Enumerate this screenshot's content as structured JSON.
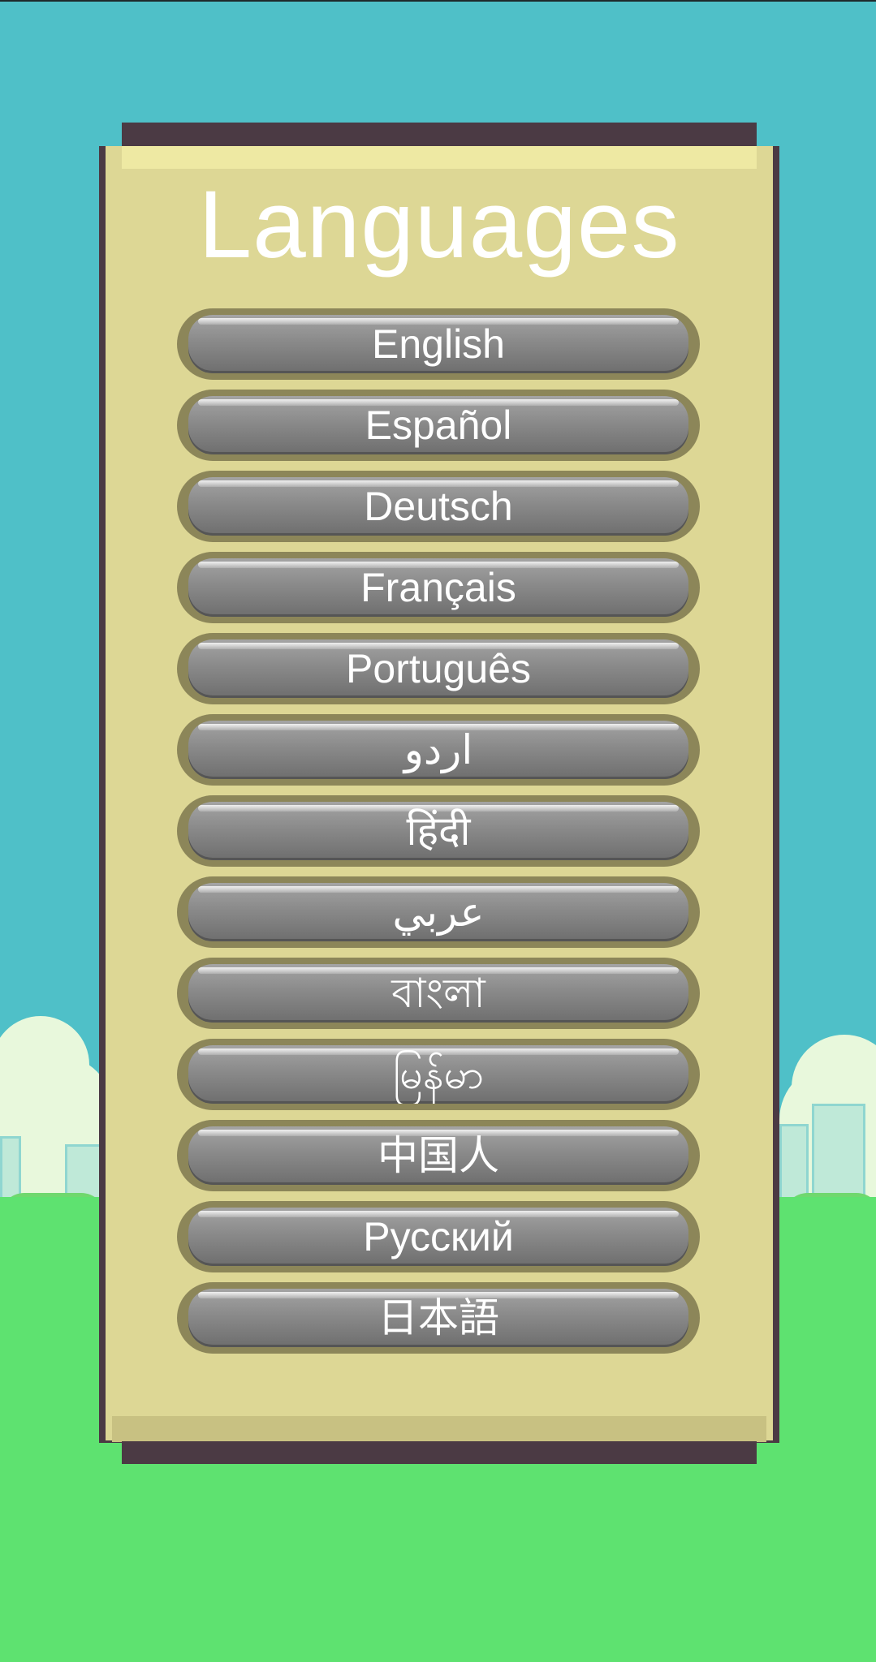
{
  "screen": {
    "title": "Languages"
  },
  "languages": [
    {
      "label": "English"
    },
    {
      "label": "Español"
    },
    {
      "label": "Deutsch"
    },
    {
      "label": "Français"
    },
    {
      "label": "Português"
    },
    {
      "label": "اردو"
    },
    {
      "label": "हिंदी"
    },
    {
      "label": "عربي"
    },
    {
      "label": "বাংলা"
    },
    {
      "label": "မြန်မာ"
    },
    {
      "label": "中国人"
    },
    {
      "label": "Русский"
    },
    {
      "label": "日本語"
    }
  ],
  "colors": {
    "sky": "#4fc0c8",
    "ground": "#5ee270",
    "panel": "#ddd795",
    "panel_border": "#4b3a44",
    "button": "#8a8a8a",
    "button_rim": "#8c8659",
    "text": "#ffffff"
  }
}
